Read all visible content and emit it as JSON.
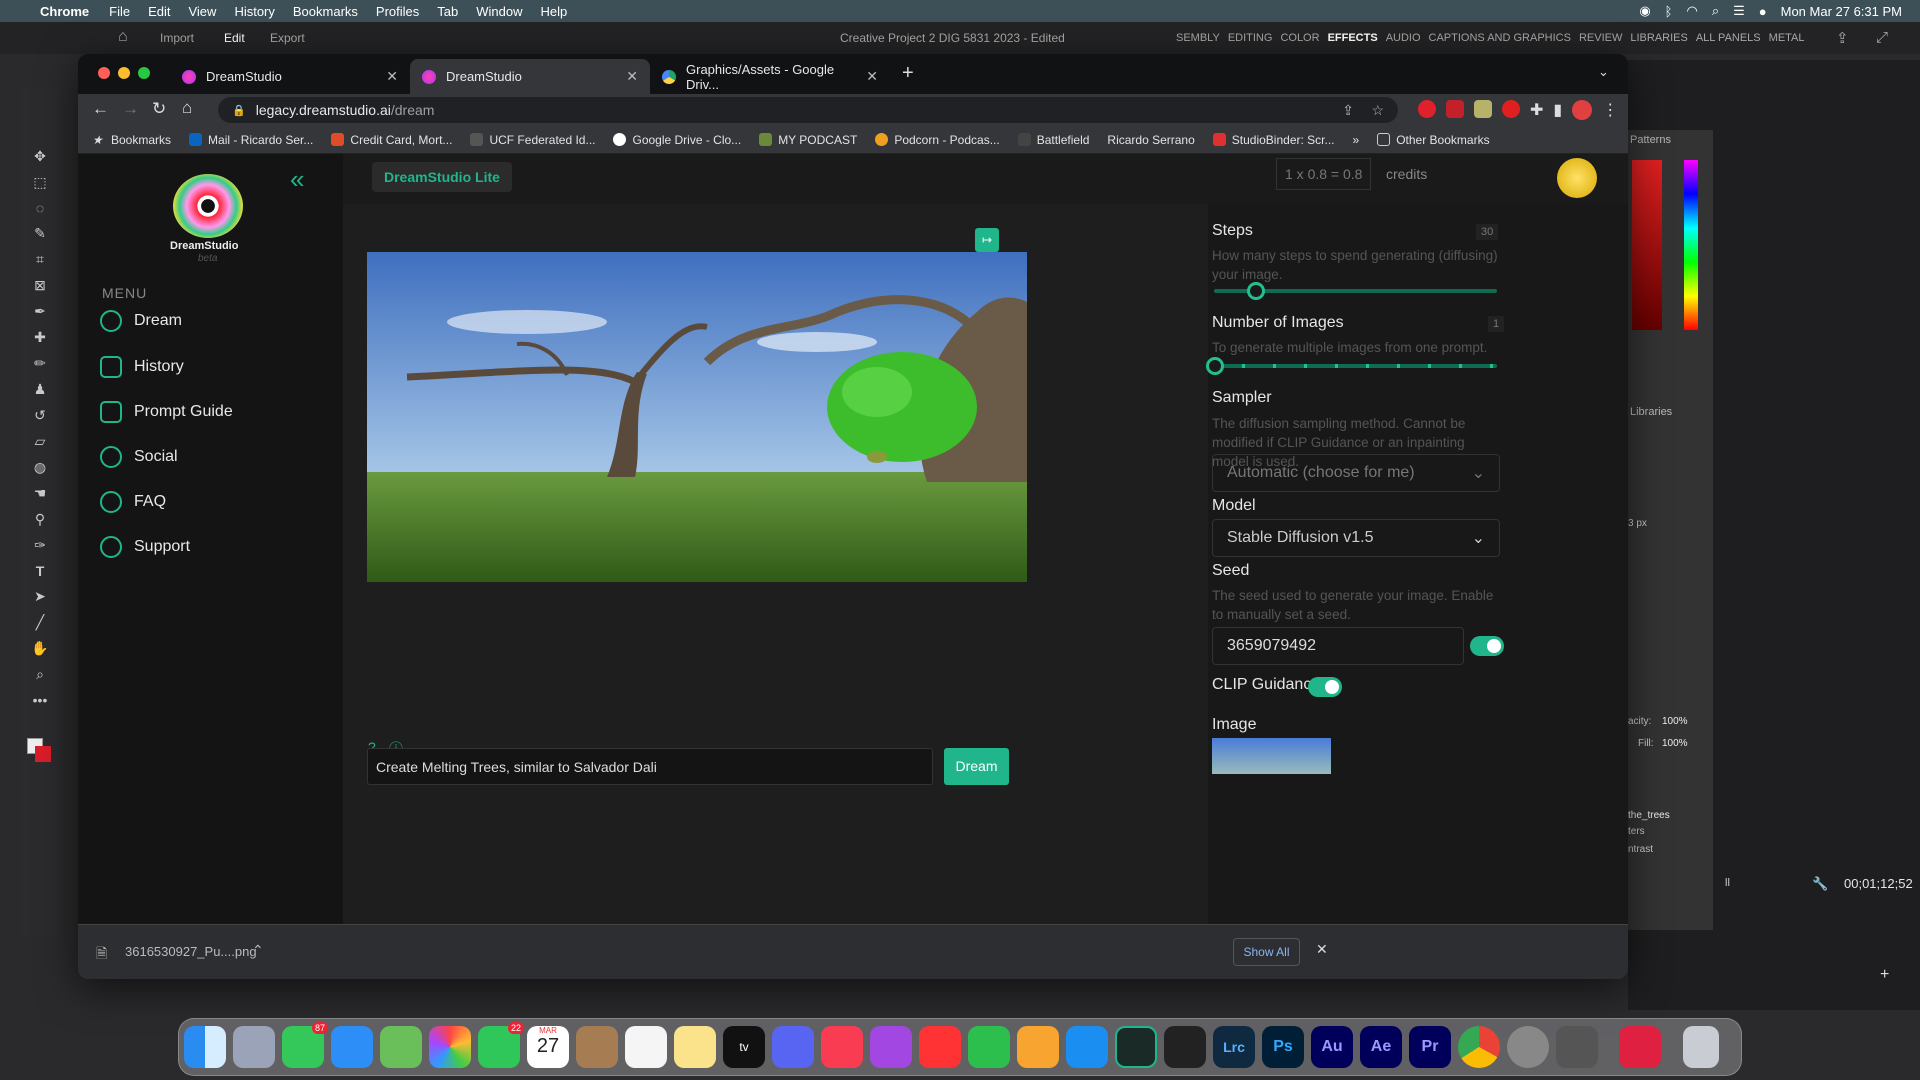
{
  "menubar": {
    "app": "Chrome",
    "items": [
      "File",
      "Edit",
      "View",
      "History",
      "Bookmarks",
      "Profiles",
      "Tab",
      "Window",
      "Help"
    ],
    "clock": "Mon Mar 27  6:31 PM"
  },
  "premiere": {
    "menu": [
      "Import",
      "Edit",
      "Export"
    ],
    "title": "Creative Project 2 DIG 5831 2023 - Edited",
    "workspaces": [
      "SEMBLY",
      "EDITING",
      "COLOR",
      "EFFECTS",
      "AUDIO",
      "CAPTIONS AND GRAPHICS",
      "REVIEW",
      "LIBRARIES",
      "ALL PANELS",
      "METAL"
    ],
    "active_workspace": "EFFECTS",
    "panels": {
      "patterns": "Patterns",
      "libraries": "Libraries"
    },
    "opacity_label": "acity:",
    "opacity": "100%",
    "fill_label": "Fill:",
    "fill": "100%",
    "px": "3 px",
    "layer": "the_trees",
    "filters": "ters",
    "contrast": "ntrast",
    "timecode": "00;01;12;52",
    "all": "ll"
  },
  "browser": {
    "tabs": [
      {
        "title": "DreamStudio",
        "active": false
      },
      {
        "title": "DreamStudio",
        "active": true
      },
      {
        "title": "Graphics/Assets - Google Driv...",
        "active": false
      }
    ],
    "url_host": "legacy.dreamstudio.ai",
    "url_path": "/dream",
    "bookmarks": [
      "Bookmarks",
      "Mail - Ricardo Ser...",
      "Credit Card, Mort...",
      "UCF Federated Id...",
      "Google Drive - Clo...",
      "MY PODCAST",
      "Podcorn - Podcas...",
      "Battlefield",
      "Ricardo Serrano",
      "StudioBinder: Scr..."
    ],
    "more": "»",
    "other_bookmarks": "Other Bookmarks"
  },
  "dreamstudio": {
    "brand": "DreamStudio",
    "beta": "beta",
    "menu_title": "MENU",
    "nav": [
      "Dream",
      "History",
      "Prompt Guide",
      "Social",
      "FAQ",
      "Support"
    ],
    "lite_label": "DreamStudio Lite",
    "cost": "1 x 0.8 = 0.8",
    "credits": "credits",
    "settings": {
      "steps_label": "Steps",
      "steps_value": "30",
      "steps_hint": "How many steps to spend generating (diffusing) your image.",
      "steps_fraction": 0.15,
      "images_label": "Number of Images",
      "images_value": "1",
      "images_hint": "To generate multiple images from one prompt.",
      "sampler_label": "Sampler",
      "sampler_hint": "The diffusion sampling method. Cannot be modified if CLIP Guidance or an inpainting model is used.",
      "sampler_value": "Automatic (choose for me)",
      "model_label": "Model",
      "model_value": "Stable Diffusion v1.5",
      "seed_label": "Seed",
      "seed_hint": "The seed used to generate your image. Enable to manually set a seed.",
      "seed_value": "3659079492",
      "clip_label": "CLIP Guidance",
      "image_label": "Image"
    },
    "prompt": "Create Melting Trees, similar to Salvador Dali",
    "dream_button": "Dream"
  },
  "download": {
    "file": "3616530927_Pu....png",
    "show_all": "Show All"
  },
  "dock": {
    "mail_badge": "87",
    "facetime_badge": "22",
    "cal_month": "MAR",
    "cal_day": "27"
  }
}
